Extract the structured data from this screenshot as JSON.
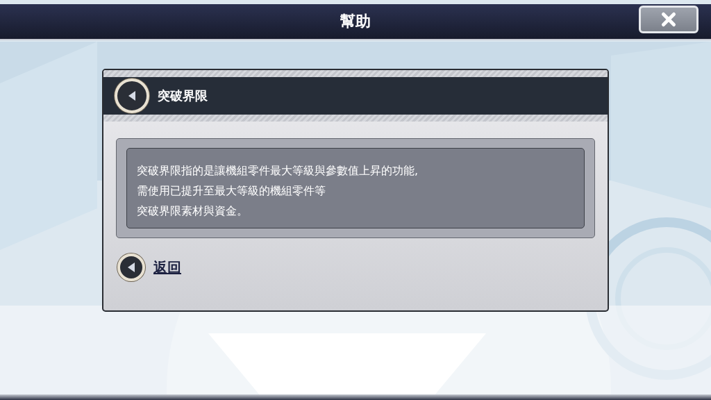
{
  "window": {
    "title": "幫助"
  },
  "section": {
    "title": "突破界限"
  },
  "description": {
    "lines": [
      "突破界限指的是讓機組零件最大等級與參數值上昇的功能,",
      "需使用已提升至最大等級的機組零件等",
      "突破界限素材與資金。"
    ]
  },
  "back_link": {
    "label": "返回"
  }
}
